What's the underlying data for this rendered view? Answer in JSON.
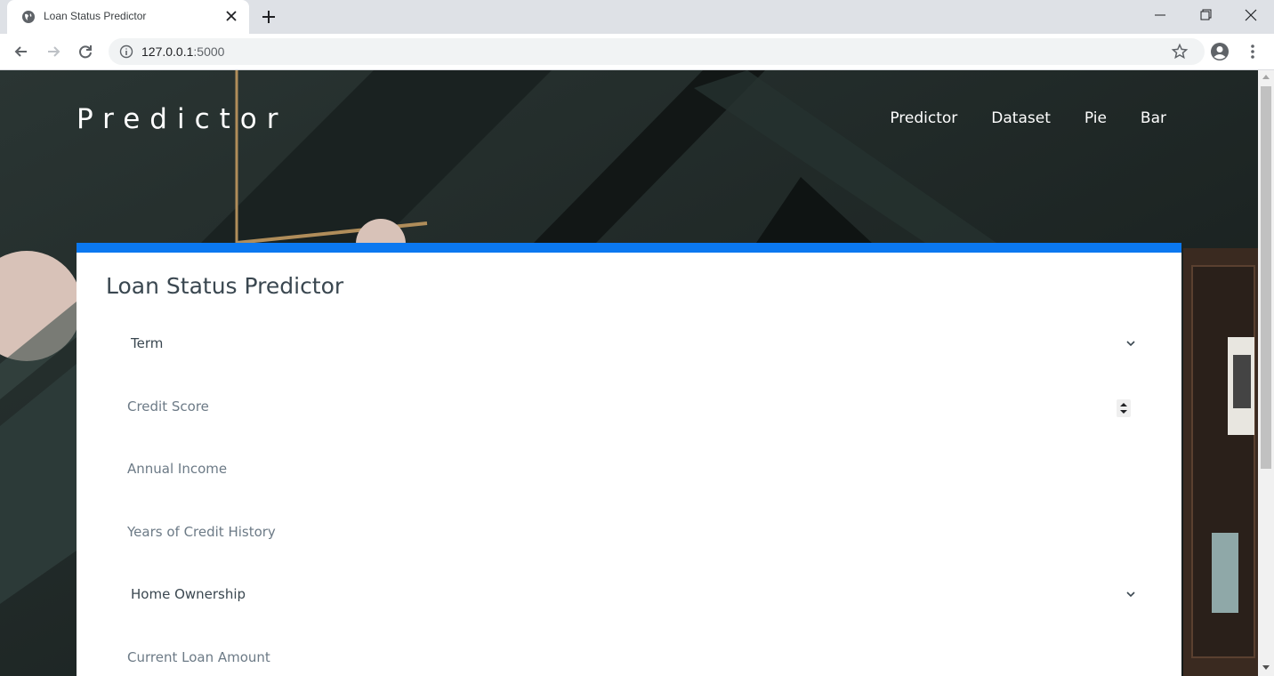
{
  "browser": {
    "tab_title": "Loan Status Predictor",
    "url_host": "127.0.0.1",
    "url_port": ":5000"
  },
  "header": {
    "brand": "Predictor",
    "nav": [
      "Predictor",
      "Dataset",
      "Pie",
      "Bar"
    ]
  },
  "form": {
    "title": "Loan Status Predictor",
    "term_label": "Term",
    "credit_score_placeholder": "Credit Score",
    "annual_income_placeholder": "Annual Income",
    "credit_history_placeholder": "Years of Credit History",
    "home_ownership_label": "Home Ownership",
    "loan_amount_placeholder": "Current Loan Amount"
  },
  "colors": {
    "accent": "#0b78f0",
    "header_bg": "#1f2624",
    "text": "#3a4750"
  },
  "icons": {
    "favicon": "globe-icon",
    "close": "close-icon",
    "new_tab": "plus-icon",
    "back": "arrow-left-icon",
    "forward": "arrow-right-icon",
    "reload": "reload-icon",
    "info": "info-icon",
    "star": "star-icon",
    "profile": "account-icon",
    "menu": "kebab-icon",
    "dropdown": "chevron-down-icon",
    "spinner": "spinner-icon"
  }
}
